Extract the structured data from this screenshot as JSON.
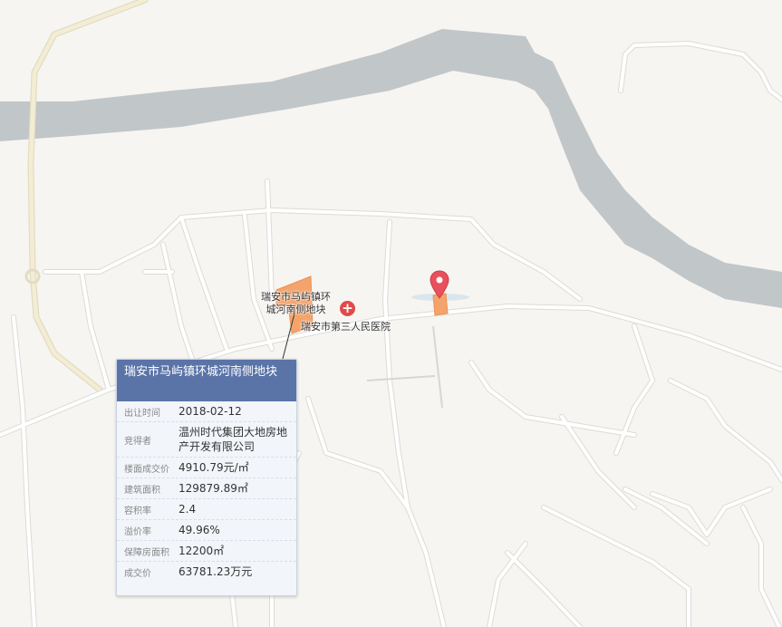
{
  "map": {
    "poi_label": "瑞安市第三人民医院",
    "parcel_label_line1": "瑞安市马屿镇环",
    "parcel_label_line2": "城河南侧地块",
    "colors": {
      "land": "#f6f5f2",
      "river": "#c1c6c8",
      "road": "#ffffff",
      "road_edge": "#dcdbd6",
      "highway": "#f0e9cf",
      "parcel": "#f4a46b",
      "hospital": "#e04a4a",
      "marker": "#e8505b"
    },
    "icons": [
      "hospital-icon",
      "map-marker-icon"
    ]
  },
  "popup": {
    "title": "瑞安市马屿镇环城河南侧地块",
    "rows": [
      {
        "key": "出让时间",
        "value": "2018-02-12"
      },
      {
        "key": "竞得者",
        "value": "温州时代集团大地房地产开发有限公司"
      },
      {
        "key": "楼面成交价",
        "value": "4910.79元/㎡"
      },
      {
        "key": "建筑面积",
        "value": "129879.89㎡"
      },
      {
        "key": "容积率",
        "value": "2.4"
      },
      {
        "key": "溢价率",
        "value": "49.96%"
      },
      {
        "key": "保障房面积",
        "value": "12200㎡"
      },
      {
        "key": "成交价",
        "value": "63781.23万元"
      }
    ]
  }
}
